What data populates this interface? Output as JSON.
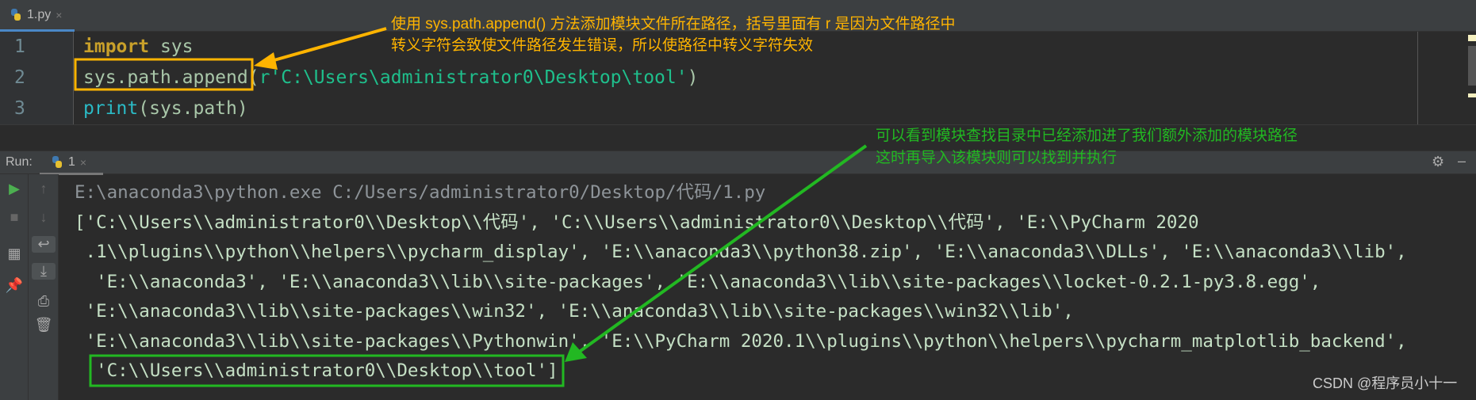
{
  "tab": {
    "filename": "1.py",
    "icon": "python-file-icon",
    "close": "×"
  },
  "editor": {
    "line_numbers": [
      "1",
      "2",
      "3"
    ],
    "lines": [
      {
        "kw": "import",
        "rest": " sys"
      },
      {
        "call": "sys.path.append(",
        "str": "r'C:\\Users\\administrator0\\Desktop\\tool'",
        "close": ")"
      },
      {
        "fn": "print",
        "rest": "(sys.path)"
      }
    ]
  },
  "run": {
    "label": "Run:",
    "tab": "1",
    "close": "×",
    "settings_icon": "gear-icon",
    "minimize_icon": "minus-icon"
  },
  "toolbar": [
    "run-icon",
    "stop-icon",
    "layout-icon",
    "pin-icon",
    "up-arrow-icon",
    "down-arrow-icon",
    "soft-wrap-icon",
    "scroll-to-end-icon",
    "print-icon",
    "trash-icon"
  ],
  "console": {
    "lines": [
      "E:\\anaconda3\\python.exe C:/Users/administrator0/Desktop/代码/1.py",
      "['C:\\\\Users\\\\administrator0\\\\Desktop\\\\代码', 'C:\\\\Users\\\\administrator0\\\\Desktop\\\\代码', 'E:\\\\PyCharm 2020",
      " .1\\\\plugins\\\\python\\\\helpers\\\\pycharm_display', 'E:\\\\anaconda3\\\\python38.zip', 'E:\\\\anaconda3\\\\DLLs', 'E:\\\\anaconda3\\\\lib',",
      "  'E:\\\\anaconda3', 'E:\\\\anaconda3\\\\lib\\\\site-packages', 'E:\\\\anaconda3\\\\lib\\\\site-packages\\\\locket-0.2.1-py3.8.egg',",
      " 'E:\\\\anaconda3\\\\lib\\\\site-packages\\\\win32', 'E:\\\\anaconda3\\\\lib\\\\site-packages\\\\win32\\\\lib',",
      " 'E:\\\\anaconda3\\\\lib\\\\site-packages\\\\Pythonwin', 'E:\\\\PyCharm 2020.1\\\\plugins\\\\python\\\\helpers\\\\pycharm_matplotlib_backend',",
      "  'C:\\\\Users\\\\administrator0\\\\Desktop\\\\tool']"
    ]
  },
  "annotations": {
    "orange": [
      "使用 sys.path.append() 方法添加模块文件所在路径，括号里面有 r 是因为文件路径中",
      "转义字符会致使文件路径发生错误，所以使路径中转义字符失效"
    ],
    "green": [
      "可以看到模块查找目录中已经添加进了我们额外添加的模块路径",
      "这时再导入该模块则可以找到并执行"
    ],
    "orange_color": "#ffb400",
    "green_color": "#22b822"
  },
  "watermark": "CSDN @程序员小十一"
}
